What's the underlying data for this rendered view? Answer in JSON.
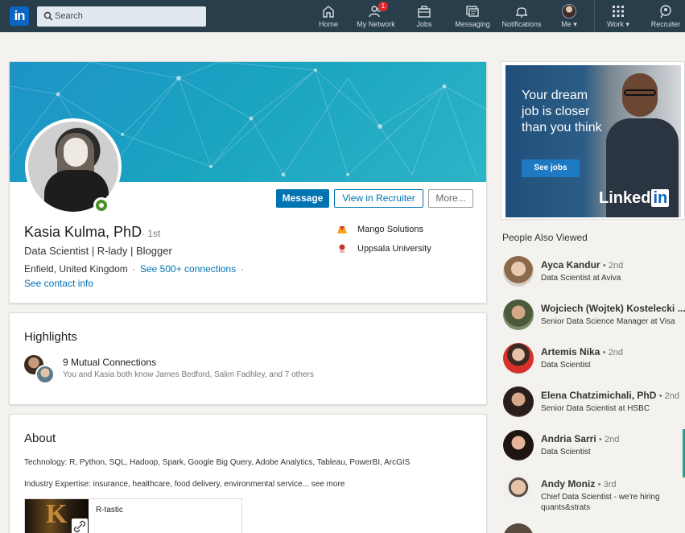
{
  "nav": {
    "search_placeholder": "Search",
    "items": [
      {
        "label": "Home",
        "icon": "home-icon"
      },
      {
        "label": "My Network",
        "icon": "network-icon",
        "badge": "1"
      },
      {
        "label": "Jobs",
        "icon": "briefcase-icon"
      },
      {
        "label": "Messaging",
        "icon": "messaging-icon"
      },
      {
        "label": "Notifications",
        "icon": "bell-icon"
      },
      {
        "label": "Me ▾",
        "icon": "avatar"
      },
      {
        "label": "Work ▾",
        "icon": "grid-icon"
      },
      {
        "label": "Recruiter",
        "icon": "recruiter-icon"
      }
    ]
  },
  "profile": {
    "name": "Kasia Kulma, PhD",
    "degree": "· 1st",
    "headline": "Data Scientist | R-lady | Blogger",
    "location": "Enfield, United Kingdom",
    "dot": "·",
    "connections": "See 500+ connections",
    "contact": "See contact info",
    "buttons": {
      "message": "Message",
      "recruiter": "View in Recruiter",
      "more": "More..."
    },
    "orgs": [
      {
        "name": "Mango Solutions",
        "color": "#f5a623"
      },
      {
        "name": "Uppsala University",
        "color": "#c0392b"
      }
    ]
  },
  "highlights": {
    "title": "Highlights",
    "mutual_title": "9 Mutual Connections",
    "mutual_sub": "You and Kasia both know James Bedford, Salim Fadhley, and 7 others"
  },
  "about": {
    "title": "About",
    "tech": "Technology: R, Python, SQL, Hadoop, Spark, Google Big Query, Adobe Analytics, Tableau, PowerBI, ArcGIS",
    "industry": "Industry Expertise: insurance, healthcare, food delivery, environmental service",
    "see_more": "... see more",
    "media_title": "R-tastic",
    "media_letter": "K"
  },
  "ad": {
    "text": "Your dream job is closer than you think",
    "button": "See jobs",
    "brand": "Linked",
    "brand_in": "in"
  },
  "pav": {
    "title": "People Also Viewed",
    "people": [
      {
        "name": "Ayca Kandur",
        "degree": "• 2nd",
        "sub": "Data Scientist at Aviva"
      },
      {
        "name": "Wojciech (Wojtek) Kostelecki ...",
        "degree": "",
        "sub": "Senior Data Science Manager at Visa"
      },
      {
        "name": "Artemis Nika",
        "degree": "• 2nd",
        "sub": "Data Scientist"
      },
      {
        "name": "Elena Chatzimichali, PhD",
        "degree": "• 2nd",
        "sub": "Senior Data Scientist at HSBC"
      },
      {
        "name": "Andria Sarri",
        "degree": "• 2nd",
        "sub": "Data Scientist"
      },
      {
        "name": "Andy Moniz",
        "degree": "• 3rd",
        "sub": "Chief Data Scientist - we're hiring quants&strats"
      }
    ]
  }
}
